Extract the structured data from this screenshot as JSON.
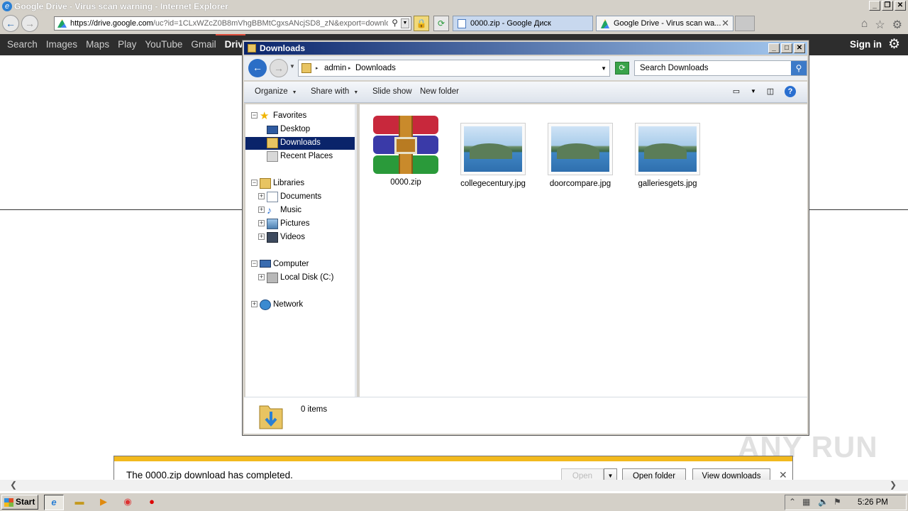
{
  "ie": {
    "title": "Google Drive - Virus scan warning - Internet Explorer",
    "url_host": "https://drive.google.com",
    "url_rest": "/uc?id=1CLxWZcZ0B8mVhgBBMtCgxsANcjSD8_zN&export=downloa",
    "tabs": [
      {
        "label": "0000.zip - Google Диск"
      },
      {
        "label": "Google Drive - Virus scan wa..."
      }
    ]
  },
  "google_bar": {
    "links": [
      "Search",
      "Images",
      "Maps",
      "Play",
      "YouTube",
      "Gmail",
      "Drive"
    ],
    "signin": "Sign in"
  },
  "explorer": {
    "title": "Downloads",
    "breadcrumb": [
      "admin",
      "Downloads"
    ],
    "search_placeholder": "Search Downloads",
    "toolbar": {
      "organize": "Organize",
      "share": "Share with",
      "slideshow": "Slide show",
      "newfolder": "New folder"
    },
    "tree": {
      "favorites": "Favorites",
      "desktop": "Desktop",
      "downloads": "Downloads",
      "recent": "Recent Places",
      "libraries": "Libraries",
      "documents": "Documents",
      "music": "Music",
      "pictures": "Pictures",
      "videos": "Videos",
      "computer": "Computer",
      "localdisk": "Local Disk (C:)",
      "network": "Network"
    },
    "files": [
      {
        "name": "0000.zip"
      },
      {
        "name": "collegecentury.jpg"
      },
      {
        "name": "doorcompare.jpg"
      },
      {
        "name": "galleriesgets.jpg"
      }
    ],
    "status": "0 items"
  },
  "download_bar": {
    "message": "The 0000.zip download has completed.",
    "open": "Open",
    "open_folder": "Open folder",
    "view_downloads": "View downloads"
  },
  "taskbar": {
    "start": "Start",
    "clock": "5:26 PM"
  },
  "watermark": "ANY RUN"
}
